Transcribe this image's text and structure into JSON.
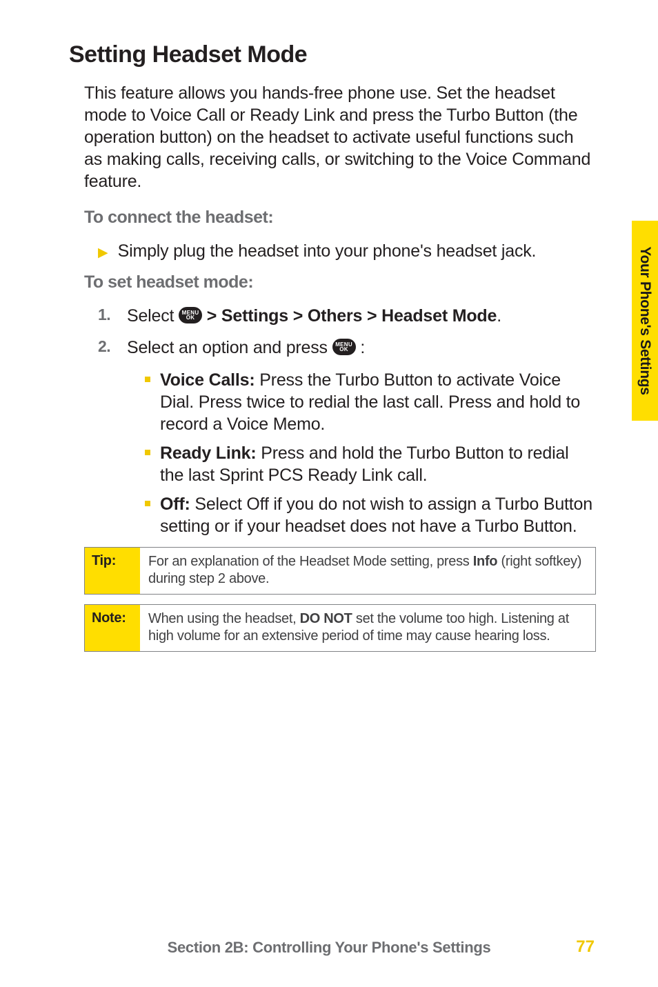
{
  "heading": "Setting Headset Mode",
  "intro": "This feature allows you hands-free phone use. Set the headset mode to Voice Call or Ready Link and press the Turbo Button (the operation button) on the headset to activate useful functions such as making calls, receiving calls, or switching to the Voice Command feature.",
  "sub1": "To connect the headset:",
  "bullet_simple": "Simply plug the headset into your phone's headset jack.",
  "sub2": "To set headset mode:",
  "step1_num": "1.",
  "step1_a": "Select ",
  "step1_b": " > Settings > Others > Headset Mode",
  "step1_c": ".",
  "step2_num": "2.",
  "step2_a": "Select an option and press ",
  "step2_b": " :",
  "menu_top": "MENU",
  "menu_bot": "OK",
  "opts": [
    {
      "label": "Voice Calls:",
      "text": " Press the Turbo Button to activate Voice Dial. Press twice to redial the last call. Press and hold to record a Voice Memo."
    },
    {
      "label": "Ready Link:",
      "text": " Press and hold the Turbo Button to redial the last Sprint PCS Ready Link call."
    },
    {
      "label": "Off:",
      "text": " Select Off if you do not wish to assign a Turbo Button setting or if your headset does not have a Turbo Button."
    }
  ],
  "tip_label": "Tip:",
  "tip_a": "For an explanation of the Headset Mode setting, press ",
  "tip_b": "Info",
  "tip_c": " (right softkey) during step 2 above.",
  "note_label": "Note:",
  "note_a": "When using the headset, ",
  "note_b": "DO NOT",
  "note_c": " set the volume too high. Listening at high volume for an extensive period of time may cause hearing loss.",
  "side_tab": "Your Phone's Settings",
  "footer": "Section 2B: Controlling Your Phone's Settings",
  "page_num": "77",
  "arrow": "▶"
}
